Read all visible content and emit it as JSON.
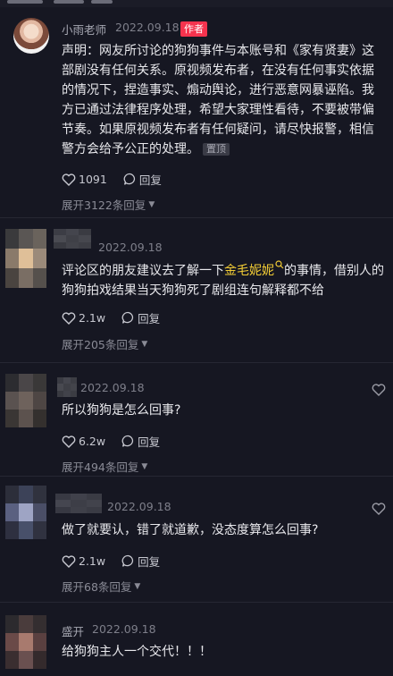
{
  "comments": [
    {
      "username": "小雨老师",
      "date": "2022.09.18",
      "author_badge": "作者",
      "text": "声明：网友所讨论的狗狗事件与本账号和《家有贤妻》这部剧没有任何关系。原视频发布者，在没有任何事实依据的情况下，捏造事实、煽动舆论，进行恶意网暴诬陷。我方已通过法律程序处理，希望大家理性看待，不要被带偏节奏。如果原视频发布者有任何疑问，请尽快报警，相信警方会给予公正的处理。",
      "pinned_label": "置顶",
      "likes": "1091",
      "reply_label": "回复",
      "expand_label": "展开3122条回复"
    },
    {
      "date": "2022.09.18",
      "text_before": "评论区的朋友建议去了解一下",
      "highlight": "金毛妮妮",
      "text_after": "的事情，借别人的狗狗拍戏结果当天狗狗死了剧组连句解释都不给",
      "likes": "2.1w",
      "reply_label": "回复",
      "expand_label": "展开205条回复"
    },
    {
      "date": "2022.09.18",
      "text": "所以狗狗是怎么回事?",
      "likes": "6.2w",
      "reply_label": "回复",
      "expand_label": "展开494条回复"
    },
    {
      "date": "2022.09.18",
      "text": "做了就要认，错了就道歉，没态度算怎么回事?",
      "likes": "2.1w",
      "reply_label": "回复",
      "expand_label": "展开68条回复"
    },
    {
      "username": "盛开",
      "date": "2022.09.18",
      "text": "给狗狗主人一个交代！！！"
    }
  ]
}
